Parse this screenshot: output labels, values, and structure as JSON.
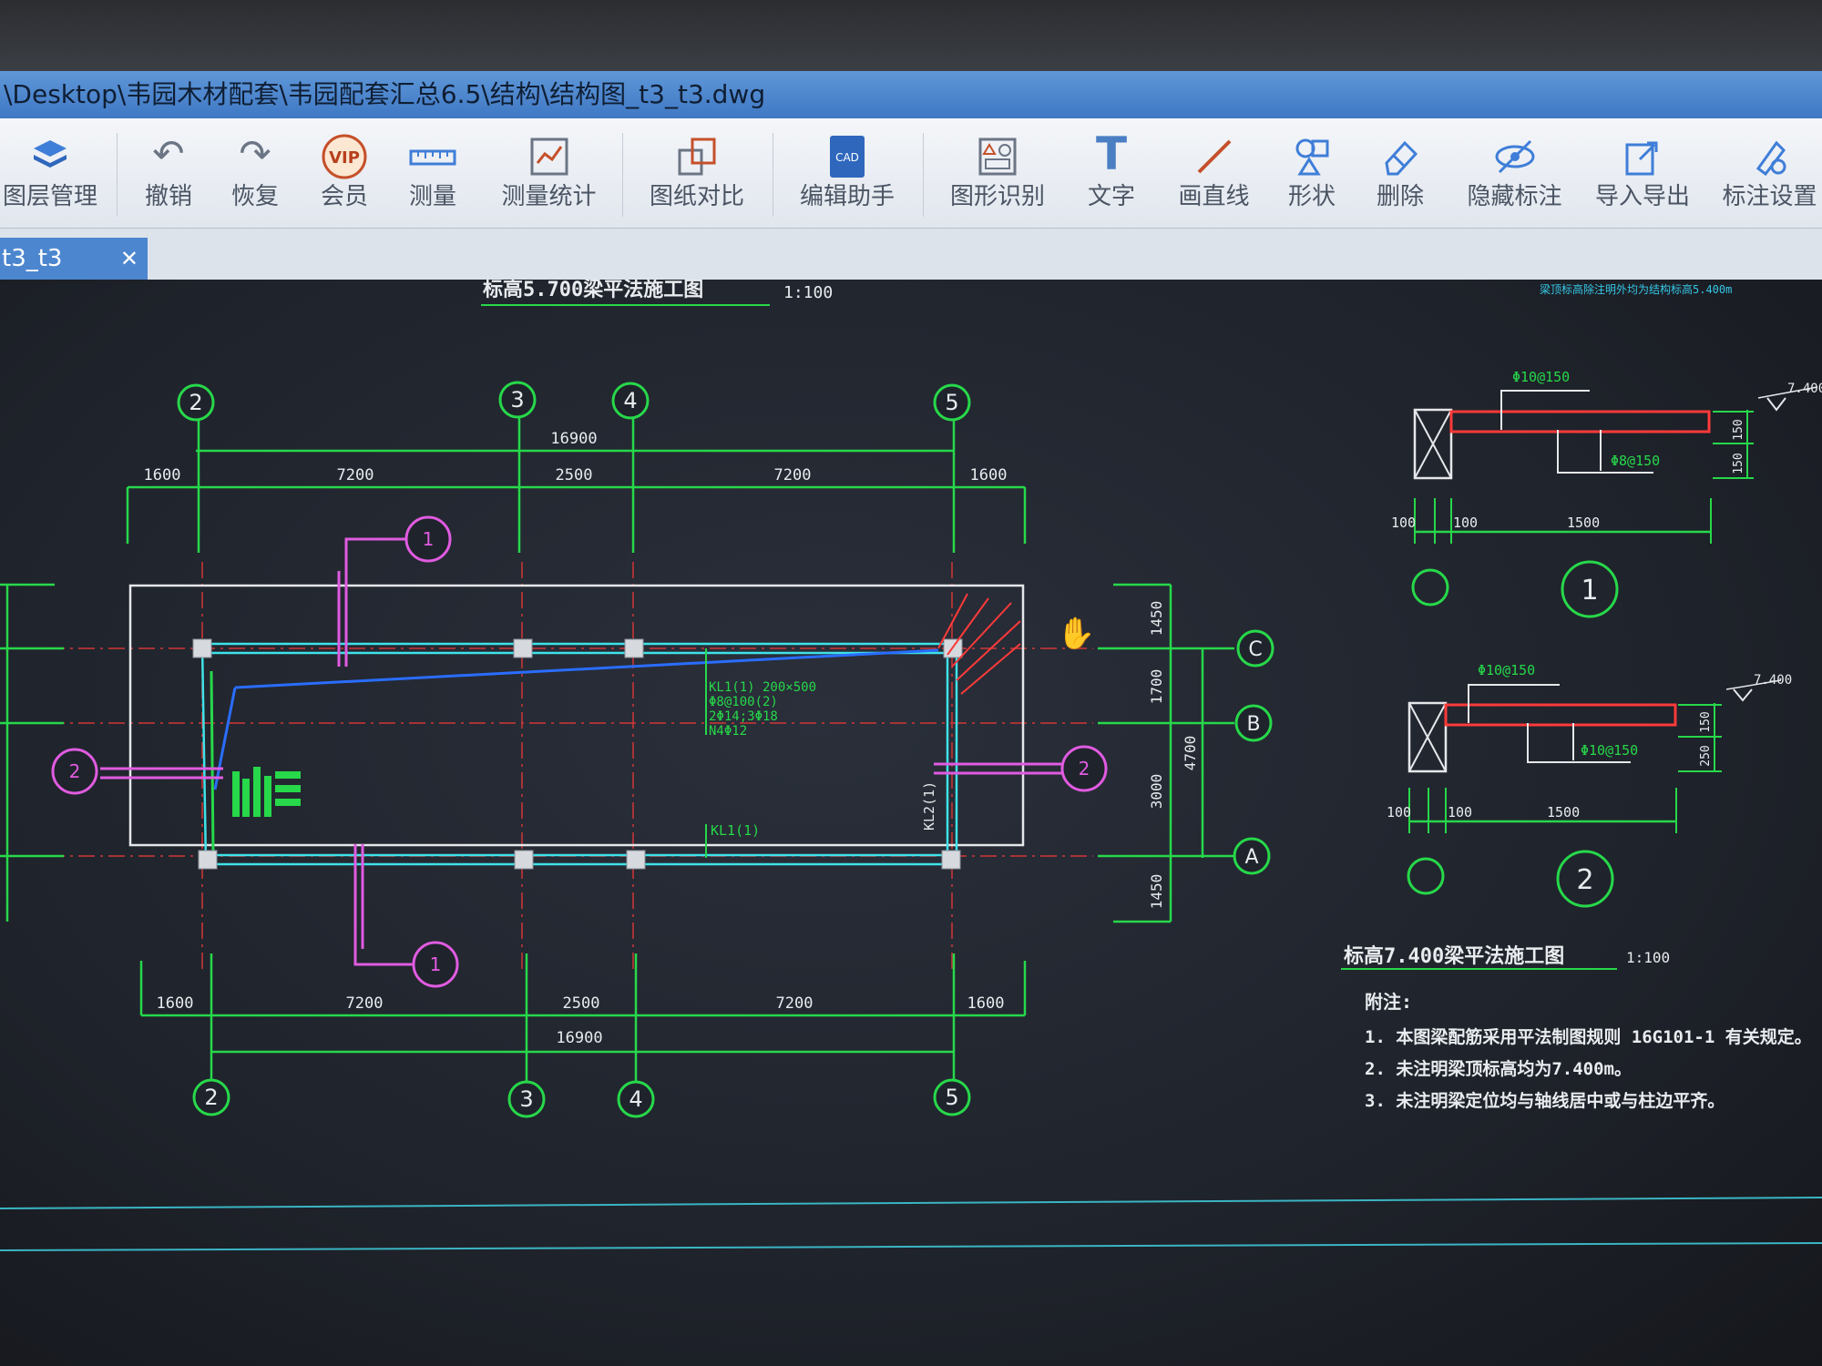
{
  "window": {
    "title": "\\Desktop\\韦园木材配套\\韦园配套汇总6.5\\结构\\结构图_t3_t3.dwg"
  },
  "toolbar": {
    "items": [
      {
        "label": "图层管理",
        "icon": "layers-icon"
      },
      {
        "label": "撤销",
        "icon": "undo-icon"
      },
      {
        "label": "恢复",
        "icon": "redo-icon"
      },
      {
        "label": "会员",
        "icon": "vip-icon"
      },
      {
        "label": "测量",
        "icon": "ruler-icon"
      },
      {
        "label": "测量统计",
        "icon": "measure-stats-icon"
      },
      {
        "label": "图纸对比",
        "icon": "compare-icon"
      },
      {
        "label": "编辑助手",
        "icon": "edit-assistant-icon"
      },
      {
        "label": "图形识别",
        "icon": "shape-recognition-icon"
      },
      {
        "label": "文字",
        "icon": "text-icon"
      },
      {
        "label": "画直线",
        "icon": "line-icon"
      },
      {
        "label": "形状",
        "icon": "shapes-icon"
      },
      {
        "label": "删除",
        "icon": "eraser-icon"
      },
      {
        "label": "隐藏标注",
        "icon": "hide-annotation-icon"
      },
      {
        "label": "导入导出",
        "icon": "import-export-icon"
      },
      {
        "label": "标注设置",
        "icon": "annotation-settings-icon"
      }
    ]
  },
  "tabs": [
    {
      "label": "t3_t3",
      "close": "✕"
    }
  ],
  "drawing": {
    "plan_title": "标高5.700梁平法施工图",
    "plan_scale": "1:100",
    "top_right_note": "梁顶标高除注明外均为结构标高5.400m",
    "section_title": "标高7.400梁平法施工图",
    "section_scale": "1:100",
    "axes_top": [
      "2",
      "3",
      "4",
      "5"
    ],
    "axes_bottom": [
      "2",
      "3",
      "4",
      "5"
    ],
    "axes_right": [
      "C",
      "B",
      "A"
    ],
    "dims_top": [
      "1600",
      "7200",
      "2500",
      "7200",
      "1600"
    ],
    "dims_bottom": [
      "1600",
      "7200",
      "2500",
      "7200",
      "1600"
    ],
    "total_dim": "16900",
    "dims_right": [
      "1450",
      "1700",
      "3000",
      "1450"
    ],
    "dim_right_total": "4700",
    "beam_label_main": "KL1(1) 200×500",
    "beam_label_line2": "Φ8@100(2)",
    "beam_label_line3": "2Φ14;3Φ18",
    "beam_label_line4": "N4Φ12",
    "beam_label_bottom": "KL1(1)",
    "beam_label_right": "KL2(1)",
    "section1": {
      "rebar_top": "Φ10@150",
      "rebar_bot": "Φ8@150",
      "dims": [
        "100",
        "100",
        "1500"
      ],
      "height": [
        "150",
        "150"
      ],
      "elev": "7.400",
      "marker": "1"
    },
    "section2": {
      "rebar_top": "Φ10@150",
      "rebar_bot": "Φ10@150",
      "dims": [
        "100",
        "100",
        "1500"
      ],
      "height": [
        "150",
        "250"
      ],
      "elev": "7.400",
      "marker": "2"
    },
    "notes_title": "附注:",
    "notes": [
      "1. 本图梁配筋采用平法制图规则 16G101-1 有关规定。",
      "2. 未注明梁顶标高均为7.400m。",
      "3. 未注明梁定位均与轴线居中或与柱边平齐。"
    ],
    "section_markers_plan": [
      "1",
      "2",
      "2",
      "1"
    ]
  }
}
